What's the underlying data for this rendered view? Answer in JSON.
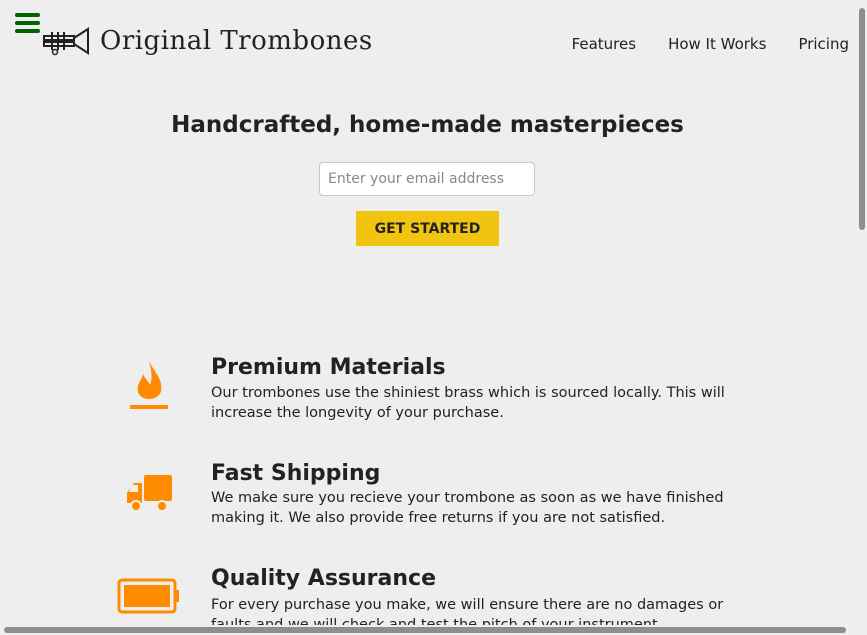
{
  "header": {
    "logo_text": "Original Trombones",
    "nav": [
      "Features",
      "How It Works",
      "Pricing"
    ]
  },
  "hero": {
    "title": "Handcrafted, home-made masterpieces",
    "email_placeholder": "Enter your email address",
    "cta_label": "GET STARTED"
  },
  "features": [
    {
      "title": "Premium Materials",
      "text": "Our trombones use the shiniest brass which is sourced locally. This will increase the longevity of your purchase."
    },
    {
      "title": "Fast Shipping",
      "text": "We make sure you recieve your trombone as soon as we have finished making it. We also provide free returns if you are not satisfied."
    },
    {
      "title": "Quality Assurance",
      "text": "For every purchase you make, we will ensure there are no damages or faults and we will check and test the pitch of your instrument."
    }
  ],
  "colors": {
    "accent": "#f1c40f",
    "icon": "#ff8c00",
    "menu": "#006400"
  },
  "icons": [
    "hamburger-icon",
    "trombone-logo-icon",
    "fire-icon",
    "truck-icon",
    "battery-icon"
  ]
}
